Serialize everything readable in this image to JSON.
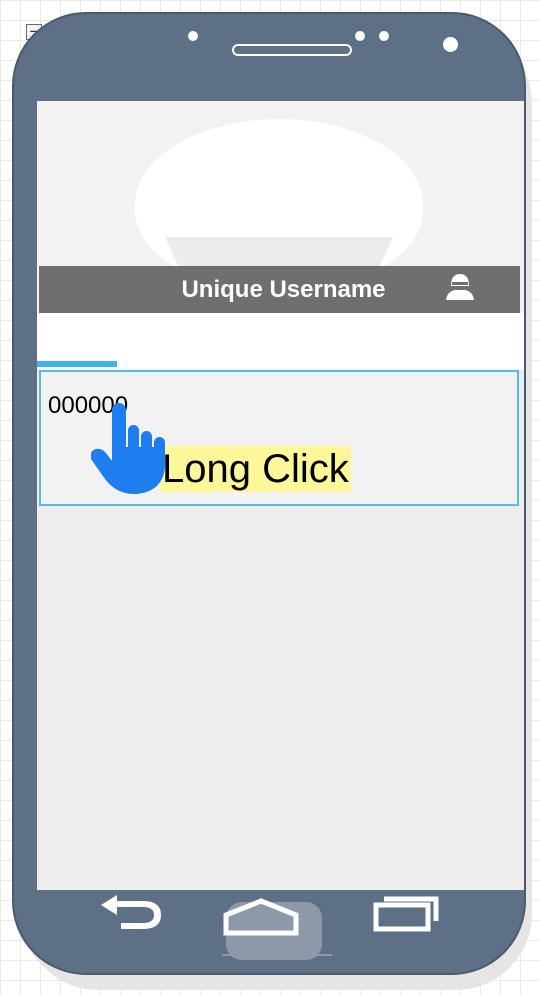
{
  "canvas": {
    "collapse_symbol": "−"
  },
  "profile": {
    "username": "Unique Username",
    "user_icon": "user-avatar-icon"
  },
  "item": {
    "value": "000000"
  },
  "hint": {
    "label": "Long Click",
    "pointer_icon": "hand-pointer-icon"
  },
  "navigation": {
    "back_icon": "back-arrow-icon",
    "home_icon": "home-icon",
    "recent_icon": "recent-apps-icon"
  },
  "colors": {
    "phone_body": "#5d7086",
    "header_bar": "#6f6f6f",
    "accent": "#3fb4e6",
    "hint_highlight": "#fff89a",
    "pointer": "#1e7ef0"
  }
}
